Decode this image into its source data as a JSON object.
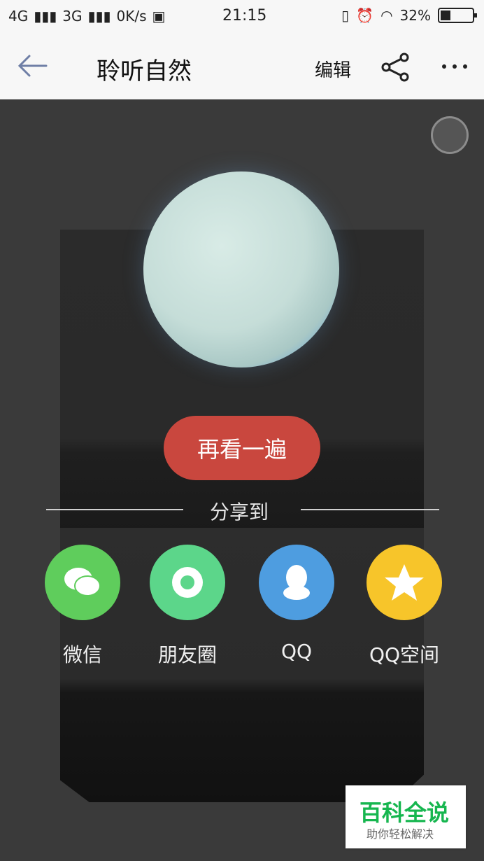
{
  "status_bar": {
    "network_left": "4G",
    "network_mid": "3G",
    "speed": "0K/s",
    "time": "21:15",
    "battery": "32%",
    "battery_level": 0.32
  },
  "app_bar": {
    "title": "聆听自然",
    "edit_label": "编辑"
  },
  "actions": {
    "replay_label": "再看一遍",
    "share_to_label": "分享到"
  },
  "share_targets": [
    {
      "label": "微信",
      "color": "#5fcd5c",
      "icon": "wechat-icon"
    },
    {
      "label": "朋友圈",
      "color": "#5cd68a",
      "icon": "moments-icon"
    },
    {
      "label": "QQ",
      "color": "#4e9de0",
      "icon": "qq-icon"
    },
    {
      "label": "QQ空间",
      "color": "#f7c52a",
      "icon": "qzone-icon"
    }
  ],
  "watermark": {
    "title": "百科全说",
    "subtitle": "助你轻松解决"
  }
}
